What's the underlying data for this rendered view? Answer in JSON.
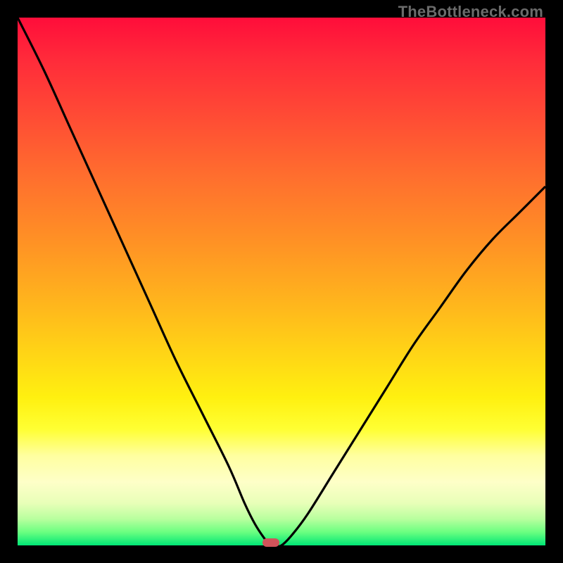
{
  "watermark": "TheBottleneck.com",
  "colors": {
    "curve": "#000000",
    "marker": "#d1535a",
    "background": "#000000"
  },
  "chart_data": {
    "type": "line",
    "title": "",
    "xlabel": "",
    "ylabel": "",
    "xlim": [
      0,
      100
    ],
    "ylim": [
      0,
      100
    ],
    "grid": false,
    "series": [
      {
        "name": "bottleneck-curve",
        "x": [
          0,
          5,
          10,
          15,
          20,
          25,
          30,
          35,
          40,
          43,
          45,
          47,
          48,
          49,
          50,
          52,
          55,
          60,
          65,
          70,
          75,
          80,
          85,
          90,
          95,
          100
        ],
        "values": [
          100,
          90,
          79,
          68,
          57,
          46,
          35,
          25,
          15,
          8,
          4,
          1,
          0,
          0,
          0,
          2,
          6,
          14,
          22,
          30,
          38,
          45,
          52,
          58,
          63,
          68
        ]
      }
    ],
    "annotations": [
      {
        "name": "optimal-marker",
        "x": 48,
        "y": 0.5,
        "shape": "pill"
      }
    ]
  }
}
